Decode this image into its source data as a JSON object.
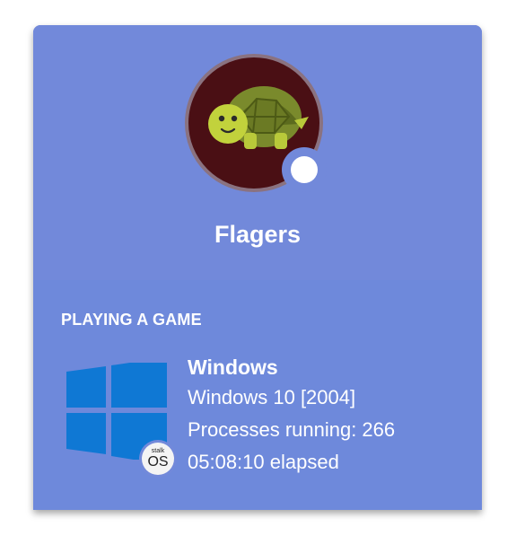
{
  "profile": {
    "username": "Flagers",
    "avatar_icon": "turtle-icon",
    "status": "online",
    "status_color": "#ffffff"
  },
  "activity": {
    "header": "PLAYING A GAME",
    "game_icon": "windows-logo-icon",
    "badge_small": "stalk",
    "badge_big": "OS",
    "game_name": "Windows",
    "details": "Windows 10 [2004]",
    "state": "Processes running: 266",
    "elapsed": "05:08:10 elapsed"
  },
  "colors": {
    "card_header": "#7289da",
    "card_activity": "#6e89db",
    "windows_blue": "#0f78d4",
    "text": "#ffffff"
  }
}
